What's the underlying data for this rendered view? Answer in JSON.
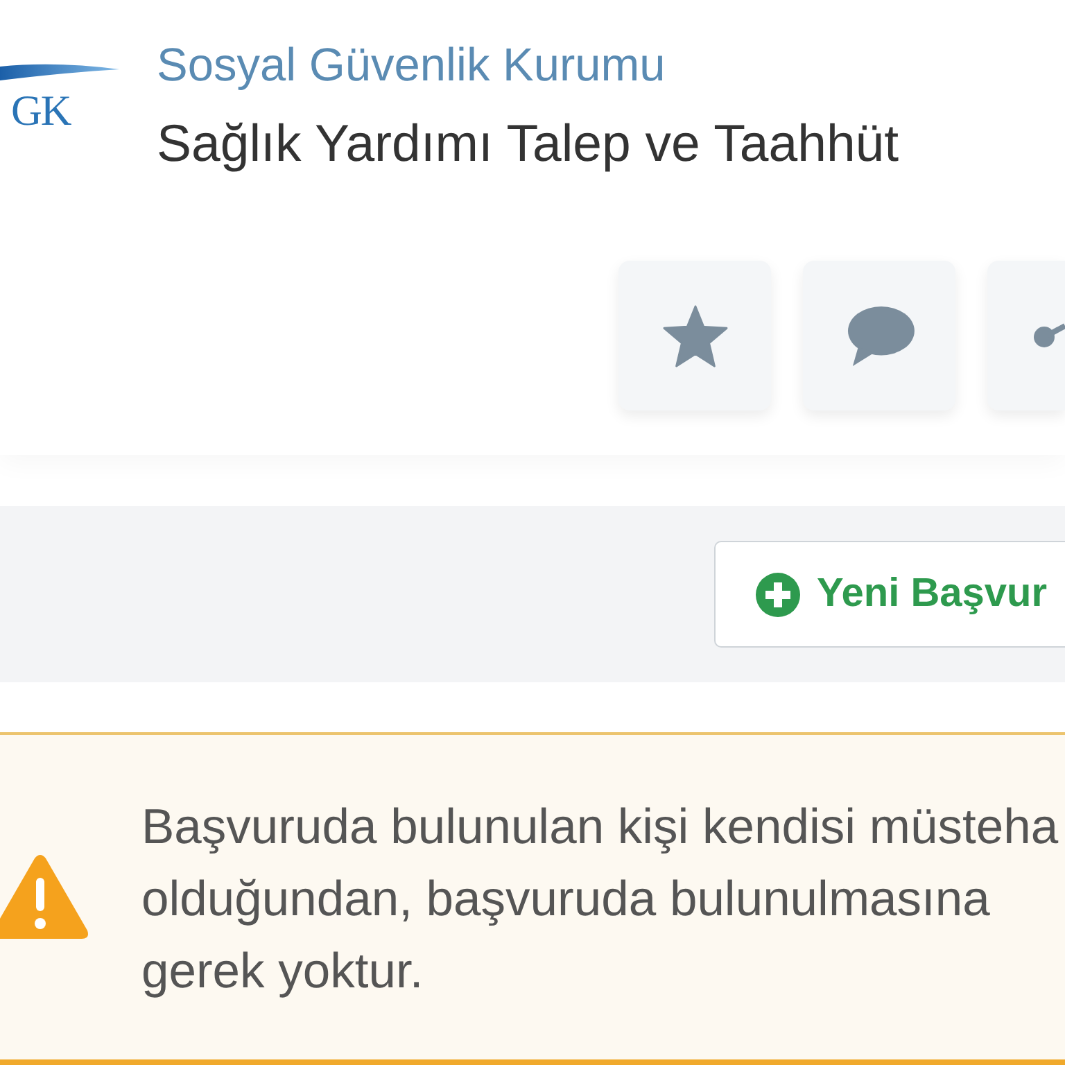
{
  "header": {
    "logo_text": "GK",
    "organization": "Sosyal Güvenlik Kurumu",
    "title": "Sağlık Yardımı Talep ve Taahhüt",
    "actions": [
      {
        "kind": "star"
      },
      {
        "kind": "comment"
      },
      {
        "kind": "share"
      }
    ]
  },
  "toolbar": {
    "new_button": {
      "label": "Yeni Başvur"
    }
  },
  "alert": {
    "kind": "warning",
    "lines": [
      "Başvuruda bulunulan kişi kendisi müsteha",
      "olduğundan, başvuruda bulunulmasına",
      "gerek yoktur."
    ]
  }
}
